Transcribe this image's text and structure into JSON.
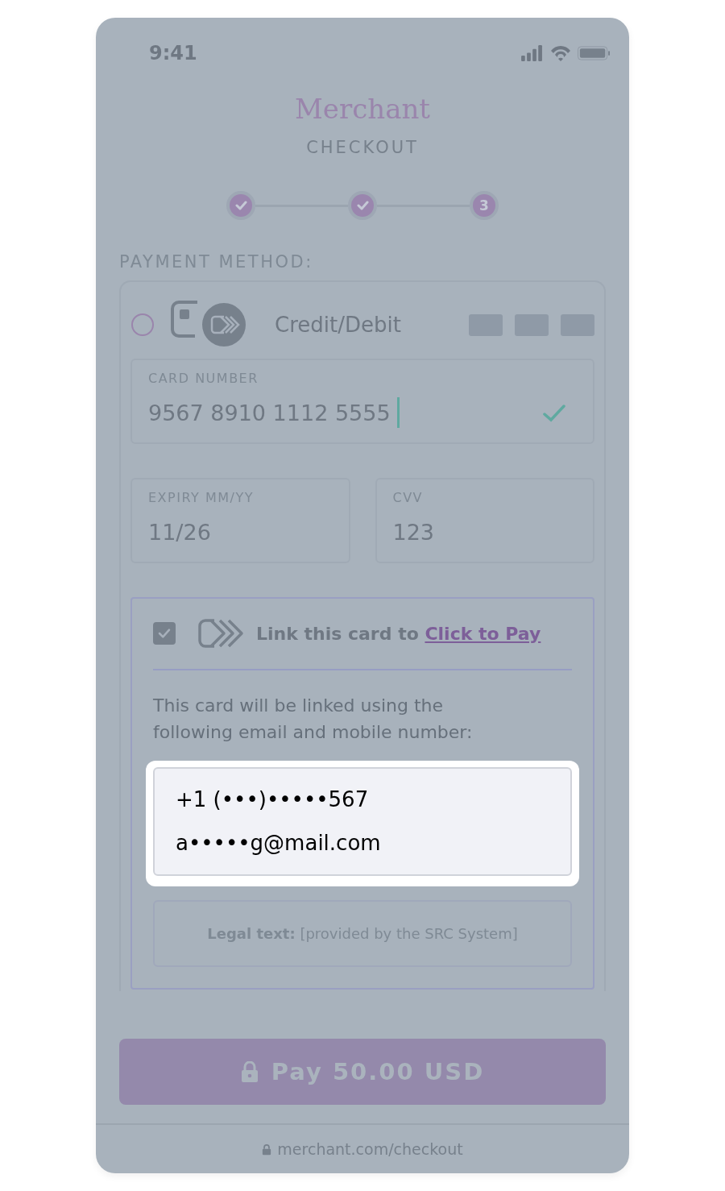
{
  "status_bar": {
    "time": "9:41"
  },
  "header": {
    "logo": "Merchant",
    "subtitle": "CHECKOUT"
  },
  "steps": [
    {
      "kind": "done"
    },
    {
      "kind": "done"
    },
    {
      "kind": "current",
      "label": "3"
    }
  ],
  "payment_method": {
    "heading": "PAYMENT METHOD:",
    "option": {
      "label": "Credit/Debit",
      "selected": false
    },
    "fields": [
      {
        "label": "CARD NUMBER",
        "value": "9567 8910 1112 5555",
        "focused": true,
        "valid": true
      },
      {
        "label": "EXPIRY MM/YY",
        "value": "11/26",
        "focused": false,
        "valid": false
      },
      {
        "label": "CVV",
        "value": "123",
        "focused": false,
        "valid": false
      }
    ],
    "link_card": {
      "checked": true,
      "text": "Link this card to",
      "link": "Click to Pay",
      "description": "This card will be linked using the following email and mobile number:",
      "contacts": [
        "+1 (•••)•••••567",
        "a•••••g@mail.com"
      ],
      "legal": "**Legal text:** [provided by the SRC System]"
    }
  },
  "pay_button": {
    "label": "Pay 50.00 USD"
  },
  "address_bar": {
    "url": "merchant.com/checkout"
  }
}
